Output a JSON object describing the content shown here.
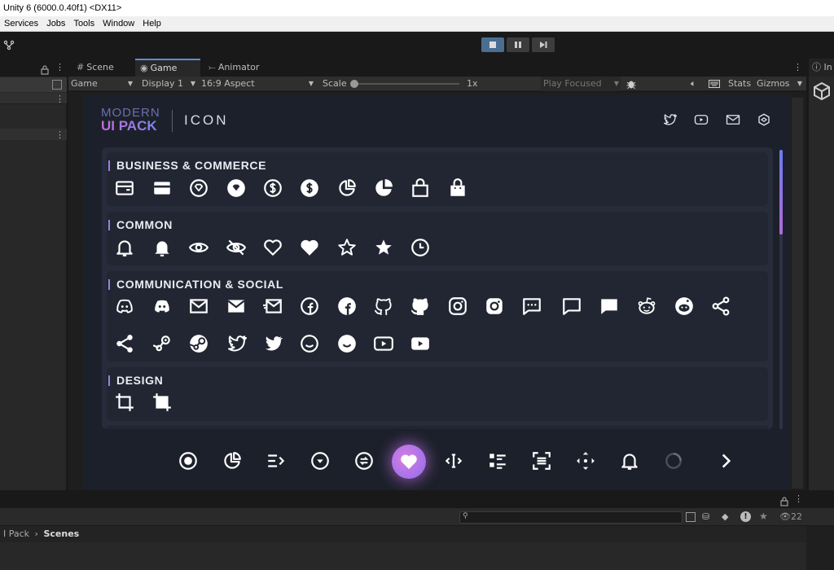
{
  "window": {
    "title": "Unity 6 (6000.0.40f1) <DX11>"
  },
  "menu": [
    "Services",
    "Jobs",
    "Tools",
    "Window",
    "Help"
  ],
  "tabs": {
    "scene": "Scene",
    "game": "Game",
    "animator": "Animator"
  },
  "gamebar": {
    "mode": "Game",
    "display": "Display 1",
    "aspect": "16:9 Aspect",
    "scale_label": "Scale",
    "scale_value": "1x",
    "play_focused": "Play Focused",
    "stats": "Stats",
    "gizmos": "Gizmos"
  },
  "right_tab_label": "In",
  "ui": {
    "logo_line1": "MODERN",
    "logo_line2": "UI PACK",
    "header_title": "ICON",
    "social_icons": [
      "twitter-icon",
      "youtube-icon",
      "mail-icon",
      "unity-icon"
    ],
    "sections": [
      {
        "title": "BUSINESS & COMMERCE"
      },
      {
        "title": "COMMON"
      },
      {
        "title": "COMMUNICATION & SOCIAL"
      },
      {
        "title": "DESIGN"
      }
    ]
  },
  "bottom": {
    "breadcrumb_part": "I Pack",
    "breadcrumb_current": "Scenes",
    "hidden_count": "22"
  },
  "colors": {
    "accent": "#5b8fd8",
    "section_bar": "#9a7fe0",
    "active_nav_from": "#7b6ff2",
    "active_nav_to": "#d16bd6"
  }
}
